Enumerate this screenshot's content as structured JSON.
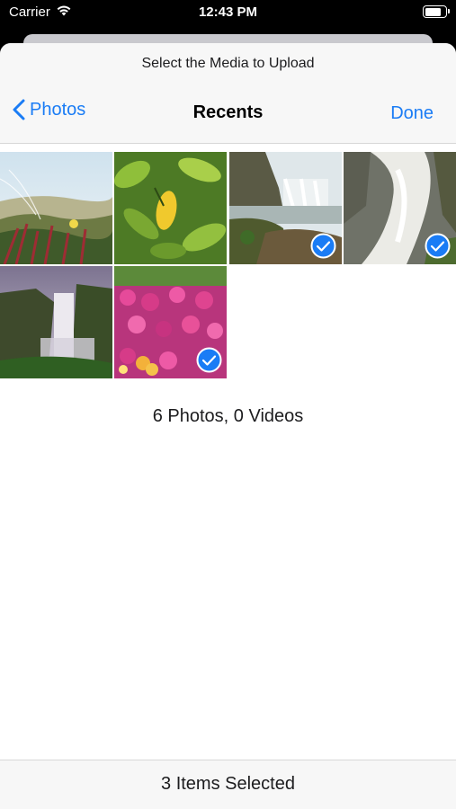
{
  "status_bar": {
    "carrier": "Carrier",
    "time": "12:43 PM",
    "battery_level": 0.85
  },
  "header": {
    "prompt": "Select the Media to Upload",
    "back_label": "Photos",
    "title": "Recents",
    "done_label": "Done"
  },
  "photos": [
    {
      "name": "photo-coastal-grass",
      "selected": false
    },
    {
      "name": "photo-lemon-leaves",
      "selected": false
    },
    {
      "name": "photo-waterfall-rocks",
      "selected": true
    },
    {
      "name": "photo-waterfall-white",
      "selected": true
    },
    {
      "name": "photo-waterfall-cliff",
      "selected": false
    },
    {
      "name": "photo-pink-flowers",
      "selected": true
    }
  ],
  "summary": {
    "count_text": "6 Photos, 0 Videos"
  },
  "toolbar": {
    "selected_text": "3 Items Selected"
  },
  "colors": {
    "accent": "#1a7cf5",
    "check_fill": "#1a7cf5"
  }
}
